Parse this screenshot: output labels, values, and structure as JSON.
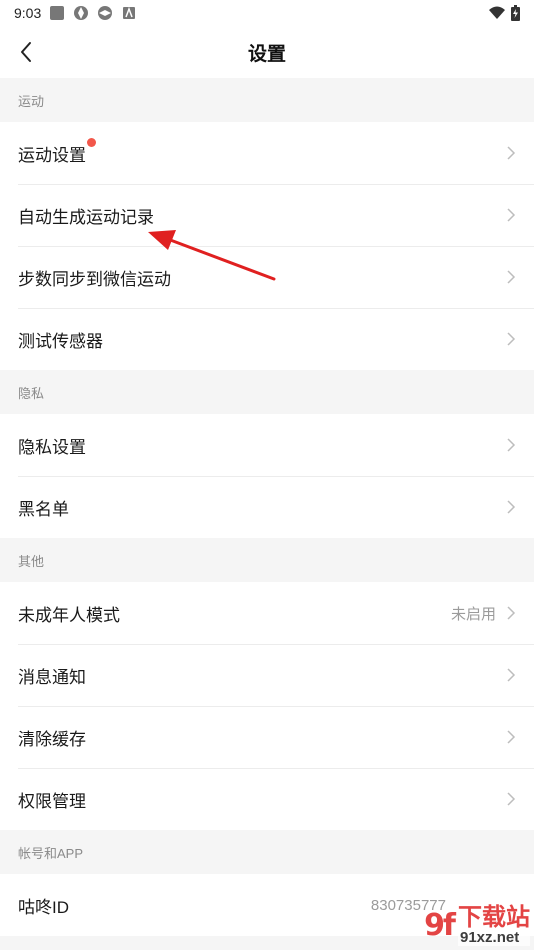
{
  "status_bar": {
    "time": "9:03"
  },
  "header": {
    "title": "设置"
  },
  "sections": [
    {
      "title": "运动",
      "items": [
        {
          "label": "运动设置",
          "badge": true
        },
        {
          "label": "自动生成运动记录"
        },
        {
          "label": "步数同步到微信运动"
        },
        {
          "label": "测试传感器"
        }
      ]
    },
    {
      "title": "隐私",
      "items": [
        {
          "label": "隐私设置"
        },
        {
          "label": "黑名单"
        }
      ]
    },
    {
      "title": "其他",
      "items": [
        {
          "label": "未成年人模式",
          "value": "未启用"
        },
        {
          "label": "消息通知"
        },
        {
          "label": "清除缓存"
        },
        {
          "label": "权限管理"
        }
      ]
    },
    {
      "title": "帐号和APP",
      "items": [
        {
          "label": "咕咚ID",
          "value": "830735777"
        }
      ]
    }
  ],
  "watermark": {
    "logo": "9f",
    "text": "下载站",
    "url": "91xz.net"
  },
  "colors": {
    "accent_red": "#f2574a",
    "annotation_red": "#e02020"
  }
}
